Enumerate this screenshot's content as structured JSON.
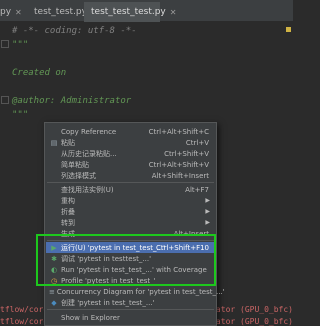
{
  "tabs": [
    {
      "label": "py",
      "icon": "python-file-icon"
    },
    {
      "label": "test_test.py",
      "icon": "python-file-icon"
    },
    {
      "label": "test_test_test.py",
      "icon": "python-file-icon",
      "active": true
    }
  ],
  "editor": {
    "lines": [
      "# -*- coding: utf-8 -*-",
      "\"\"\"",
      "Created on",
      "",
      "@author: Administrator",
      "\"\"\""
    ]
  },
  "console": {
    "line1_left": "tflow/core/",
    "line1_right": "ocator (GPU_0_bfc)",
    "line2_left": "tflow/core/",
    "line2_right": "ocator (GPU_0_bfc)"
  },
  "menu": {
    "items": [
      {
        "label": "Copy Reference",
        "shortcut": "Ctrl+Alt+Shift+C"
      },
      {
        "label": "粘贴",
        "shortcut": "Ctrl+V",
        "icon": "paste-icon"
      },
      {
        "label": "从历史记录粘贴...",
        "shortcut": "Ctrl+Shift+V"
      },
      {
        "label": "简单粘贴",
        "shortcut": "Ctrl+Alt+Shift+V"
      },
      {
        "label": "列选择模式",
        "shortcut": "Alt+Shift+Insert"
      },
      {
        "label": "查找用法实例(U)",
        "shortcut": "Alt+F7"
      },
      {
        "label": "重构",
        "submenu": true
      },
      {
        "label": "折叠",
        "submenu": true
      },
      {
        "label": "转到",
        "submenu": true
      },
      {
        "label": "生成...",
        "shortcut": "Alt+Insert"
      },
      {
        "label": "运行(U) 'pytest in test_test_...'",
        "shortcut": "Ctrl+Shift+F10",
        "icon": "run-icon",
        "selected": true
      },
      {
        "label": "调试 'pytest in testtest_...'",
        "icon": "debug-icon"
      },
      {
        "label": "Run 'pytest in test_test_...' with Coverage",
        "icon": "coverage-icon"
      },
      {
        "label": "Profile 'pytest in test_test_'",
        "icon": "profile-icon"
      },
      {
        "label": "Concurrency Diagram for 'pytest in test_test_...'",
        "icon": "concurrency-icon"
      },
      {
        "label": "创建 'pytest in test_test_...'",
        "icon": "python-config-icon"
      },
      {
        "label": "Show in Explorer"
      }
    ]
  },
  "colors": {
    "highlight_box": "#1dc81d",
    "selected_item": "#4b6eaf"
  }
}
